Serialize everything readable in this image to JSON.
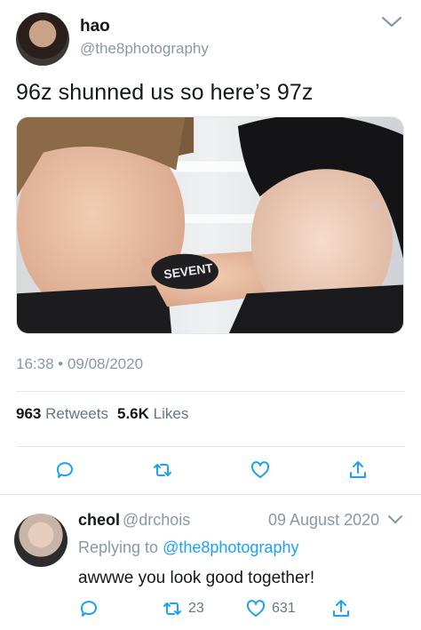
{
  "tweet": {
    "author": {
      "name": "hao",
      "handle": "@the8photography"
    },
    "text": "96z shunned us so here’s 97z",
    "media": {
      "wristband_text": "SEVENT"
    },
    "timestamp": "16:38 • 09/08/2020",
    "stats": {
      "retweets_count": "963",
      "retweets_label": "Retweets",
      "likes_count": "5.6K",
      "likes_label": "Likes"
    },
    "icons": [
      "reply-icon",
      "retweet-icon",
      "like-icon",
      "share-icon"
    ]
  },
  "reply": {
    "author": {
      "name": "cheol",
      "handle": "@drchois"
    },
    "date": "09 August 2020",
    "replying_prefix": "Replying to",
    "replying_to": "@the8photography",
    "text": "awwwe you look good together!",
    "retweets": "23",
    "likes": "631"
  },
  "colors": {
    "link": "#1da1f2",
    "muted": "#8899a6",
    "text": "#14171a",
    "divider": "#e1e8ed"
  }
}
